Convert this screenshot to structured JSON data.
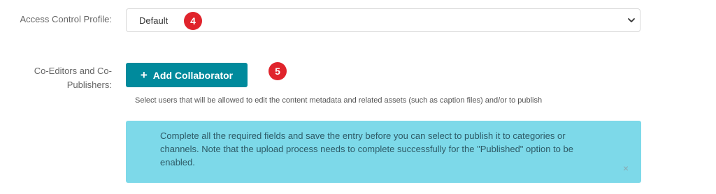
{
  "access_control": {
    "label": "Access Control Profile:",
    "selected_value": "Default"
  },
  "badges": {
    "first": "4",
    "second": "5"
  },
  "co_editors": {
    "label": "Co-Editors and Co-Publishers:",
    "add_button_label": "Add Collaborator",
    "add_button_icon": "+",
    "helper_text": "Select users that will be allowed to edit the content metadata and related assets (such as caption files) and/or to publish"
  },
  "alert": {
    "message": "Complete all the required fields and save the entry before you can select to publish it to categories or channels. Note that the upload process needs to complete successfully for the \"Published\" option to be enabled.",
    "close_symbol": "×"
  },
  "colors": {
    "button_bg": "#008a9c",
    "alert_bg": "#7dd9e9",
    "badge_bg": "#e0242c"
  }
}
